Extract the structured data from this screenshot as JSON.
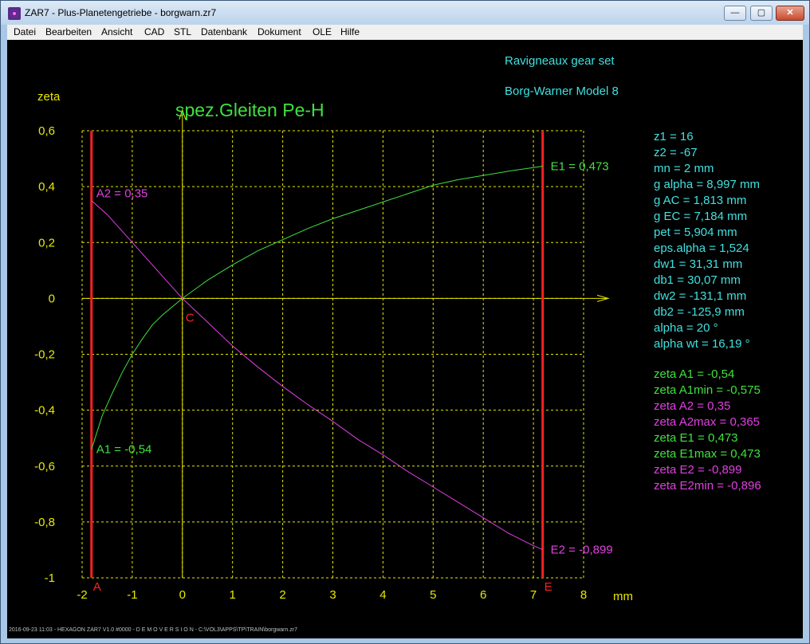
{
  "window": {
    "title": "ZAR7 - Plus-Planetengetriebe  -  borgwarn.zr7",
    "buttons": {
      "minimize": "—",
      "maximize": "▢",
      "close": "✕"
    }
  },
  "menu": [
    "Datei",
    "Bearbeiten",
    "Ansicht",
    "CAD",
    "STL",
    "Datenbank",
    "Dokument",
    "OLE",
    "Hilfe"
  ],
  "header": {
    "line1": "Ravigneaux gear set",
    "line2": "Borg-Warner Model 8"
  },
  "colors": {
    "cyan": "#40e0e0",
    "green": "#40e040",
    "magenta": "#e040e0",
    "yellow": "#e8e800",
    "red": "#ff2020",
    "bg": "#000000"
  },
  "params": [
    "z1 = 16",
    "z2 = -67",
    "mn = 2 mm",
    "g alpha = 8,997 mm",
    "g AC = 1,813 mm",
    "g EC = 7,184 mm",
    "pet = 5,904 mm",
    "eps.alpha = 1,524",
    "dw1 = 31,31 mm",
    "db1 = 30,07 mm",
    "dw2 = -131,1 mm",
    "db2 = -125,9 mm",
    "alpha = 20 °",
    "alpha wt = 16,19 °"
  ],
  "results": [
    {
      "text": "zeta A1 = -0,54",
      "color": "green"
    },
    {
      "text": "zeta A1min = -0,575",
      "color": "green"
    },
    {
      "text": "zeta A2 = 0,35",
      "color": "magenta"
    },
    {
      "text": "zeta A2max = 0,365",
      "color": "magenta"
    },
    {
      "text": "zeta E1 = 0,473",
      "color": "green"
    },
    {
      "text": "zeta E1max = 0,473",
      "color": "green"
    },
    {
      "text": "zeta E2 = -0,899",
      "color": "magenta"
    },
    {
      "text": "zeta E2min = -0,896",
      "color": "magenta"
    }
  ],
  "statusline": "2016-09-23 11:03 - HEXAGON ZAR7 V1.0 #0000 - D E M O V E R S I O N - C:\\VOL3\\APPS\\TP\\TRAIN\\borgwarn.zr7",
  "chart_data": {
    "type": "line",
    "title": "spez.Gleiten Pe-H",
    "xlabel": "mm",
    "ylabel": "zeta",
    "xlim": [
      -2,
      8
    ],
    "ylim": [
      -1,
      0.6
    ],
    "xticks": [
      -2,
      -1,
      0,
      1,
      2,
      3,
      4,
      5,
      6,
      7,
      8
    ],
    "yticks": [
      0.6,
      0.4,
      0.2,
      0,
      -0.2,
      -0.4,
      -0.6,
      -0.8,
      -1
    ],
    "xtick_labels": [
      "-2",
      "-1",
      "0",
      "1",
      "2",
      "3",
      "4",
      "5",
      "6",
      "7",
      "8"
    ],
    "ytick_labels": [
      "0,6",
      "0,4",
      "0,2",
      "0",
      "-0,2",
      "-0,4",
      "-0,6",
      "-0,8",
      "-1"
    ],
    "grid": true,
    "markers": [
      {
        "label": "A",
        "x": -1.813
      },
      {
        "label": "E",
        "x": 7.184
      }
    ],
    "pitch_point_label": "C",
    "series": [
      {
        "color": "green",
        "curve": "z1",
        "x": [
          -1.813,
          -1.6,
          -1.4,
          -1.2,
          -1.0,
          -0.8,
          -0.6,
          -0.4,
          -0.2,
          0,
          0.5,
          1,
          1.5,
          2,
          2.5,
          3,
          3.5,
          4,
          4.5,
          5,
          5.5,
          6,
          6.5,
          7,
          7.184
        ],
        "y": [
          -0.54,
          -0.42,
          -0.34,
          -0.265,
          -0.2,
          -0.145,
          -0.095,
          -0.06,
          -0.03,
          0,
          0.065,
          0.12,
          0.17,
          0.21,
          0.25,
          0.285,
          0.315,
          0.345,
          0.375,
          0.405,
          0.425,
          0.44,
          0.455,
          0.468,
          0.473
        ]
      },
      {
        "color": "magenta",
        "curve": "z2",
        "x": [
          -1.813,
          -1.5,
          -1.0,
          -0.5,
          0,
          0.5,
          1,
          1.5,
          2,
          2.5,
          3,
          3.5,
          4,
          4.5,
          5,
          5.5,
          6,
          6.5,
          7,
          7.184
        ],
        "y": [
          0.35,
          0.3,
          0.2,
          0.1,
          0,
          -0.085,
          -0.17,
          -0.245,
          -0.315,
          -0.38,
          -0.44,
          -0.505,
          -0.56,
          -0.62,
          -0.675,
          -0.73,
          -0.785,
          -0.84,
          -0.885,
          -0.899
        ]
      }
    ],
    "annotations": [
      {
        "text": "A2 = 0,35",
        "x": -1.813,
        "y": 0.35,
        "color": "magenta",
        "dx": 6,
        "dy": -4
      },
      {
        "text": "A1 = -0,54",
        "x": -1.813,
        "y": -0.54,
        "color": "green",
        "dx": 6,
        "dy": 5
      },
      {
        "text": "E1 = 0,473",
        "x": 7.184,
        "y": 0.473,
        "color": "green",
        "dx": 10,
        "dy": 5
      },
      {
        "text": "E2 = -0,899",
        "x": 7.184,
        "y": -0.899,
        "color": "magenta",
        "dx": 10,
        "dy": 5
      }
    ]
  }
}
